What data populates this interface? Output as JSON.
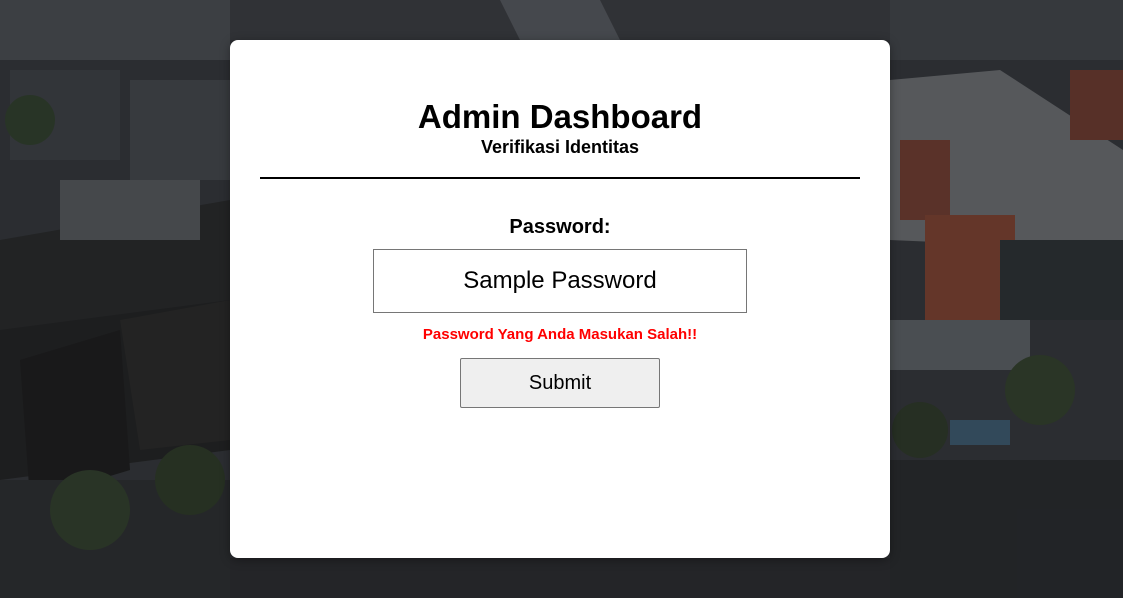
{
  "page": {
    "title": "Admin Dashboard",
    "subtitle": "Verifikasi Identitas"
  },
  "form": {
    "password_label": "Password:",
    "password_value": "Sample Password",
    "error_message": "Password Yang Anda Masukan Salah!!",
    "submit_label": "Submit"
  },
  "colors": {
    "error": "#ff0000",
    "card_background": "#ffffff",
    "button_background": "#efefef"
  },
  "background": {
    "description_icon": "aerial-city-photo"
  }
}
